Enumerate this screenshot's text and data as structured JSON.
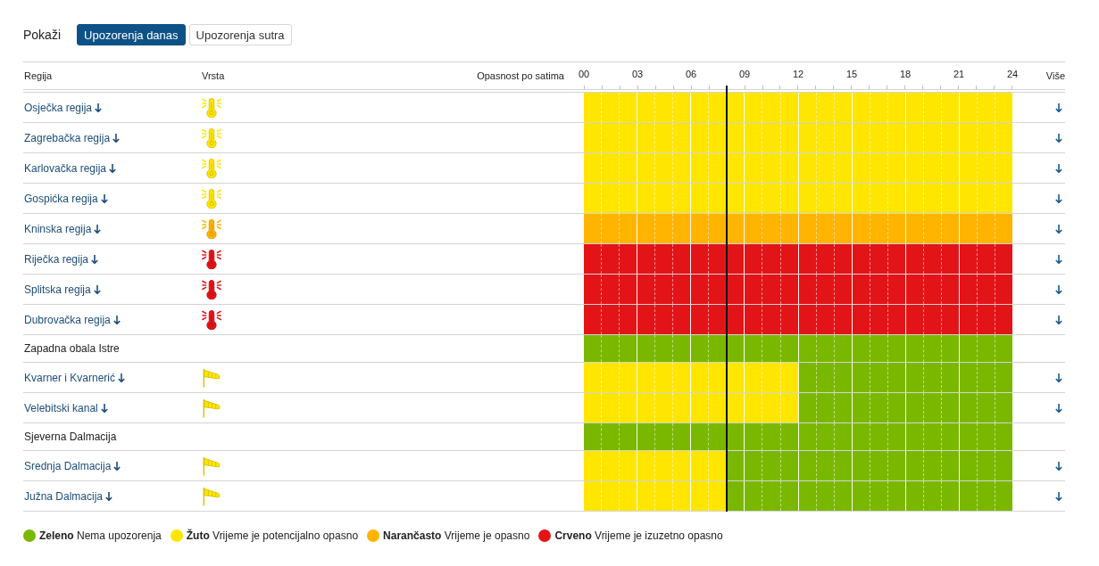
{
  "filter": {
    "label": "Pokaži",
    "tabs": [
      {
        "label": "Upozorenja danas",
        "selected": true
      },
      {
        "label": "Upozorenja sutra",
        "selected": false
      }
    ]
  },
  "table": {
    "columns": {
      "region": "Regija",
      "type": "Vrsta",
      "hazard": "Opasnost po satima",
      "more": "Više"
    },
    "hours": [
      "00",
      "03",
      "06",
      "09",
      "12",
      "15",
      "18",
      "21",
      "24"
    ],
    "now_line": {
      "level": 0.3333
    },
    "rows": [
      {
        "region": "Osječka regija",
        "expandable": true,
        "icon": {
          "kind": "heat",
          "color": "#ffe600"
        },
        "hourly": [
          {
            "color": "#ffe600"
          },
          {
            "color": "#ffe600"
          },
          {
            "color": "#ffe600"
          },
          {
            "color": "#ffe600"
          },
          {
            "color": "#ffe600"
          },
          {
            "color": "#ffe600"
          },
          {
            "color": "#ffe600"
          },
          {
            "color": "#ffe600"
          },
          {
            "color": "#ffe600"
          },
          {
            "color": "#ffe600"
          },
          {
            "color": "#ffe600"
          },
          {
            "color": "#ffe600"
          },
          {
            "color": "#ffe600"
          },
          {
            "color": "#ffe600"
          },
          {
            "color": "#ffe600"
          },
          {
            "color": "#ffe600"
          },
          {
            "color": "#ffe600"
          },
          {
            "color": "#ffe600"
          },
          {
            "color": "#ffe600"
          },
          {
            "color": "#ffe600"
          },
          {
            "color": "#ffe600"
          },
          {
            "color": "#ffe600"
          },
          {
            "color": "#ffe600"
          },
          {
            "color": "#ffe600"
          }
        ]
      },
      {
        "region": "Zagrebačka regija",
        "expandable": true,
        "icon": {
          "kind": "heat",
          "color": "#ffe600"
        },
        "hourly": [
          {
            "color": "#ffe600"
          },
          {
            "color": "#ffe600"
          },
          {
            "color": "#ffe600"
          },
          {
            "color": "#ffe600"
          },
          {
            "color": "#ffe600"
          },
          {
            "color": "#ffe600"
          },
          {
            "color": "#ffe600"
          },
          {
            "color": "#ffe600"
          },
          {
            "color": "#ffe600"
          },
          {
            "color": "#ffe600"
          },
          {
            "color": "#ffe600"
          },
          {
            "color": "#ffe600"
          },
          {
            "color": "#ffe600"
          },
          {
            "color": "#ffe600"
          },
          {
            "color": "#ffe600"
          },
          {
            "color": "#ffe600"
          },
          {
            "color": "#ffe600"
          },
          {
            "color": "#ffe600"
          },
          {
            "color": "#ffe600"
          },
          {
            "color": "#ffe600"
          },
          {
            "color": "#ffe600"
          },
          {
            "color": "#ffe600"
          },
          {
            "color": "#ffe600"
          },
          {
            "color": "#ffe600"
          }
        ]
      },
      {
        "region": "Karlovačka regija",
        "expandable": true,
        "icon": {
          "kind": "heat",
          "color": "#ffe600"
        },
        "hourly": [
          {
            "color": "#ffe600"
          },
          {
            "color": "#ffe600"
          },
          {
            "color": "#ffe600"
          },
          {
            "color": "#ffe600"
          },
          {
            "color": "#ffe600"
          },
          {
            "color": "#ffe600"
          },
          {
            "color": "#ffe600"
          },
          {
            "color": "#ffe600"
          },
          {
            "color": "#ffe600"
          },
          {
            "color": "#ffe600"
          },
          {
            "color": "#ffe600"
          },
          {
            "color": "#ffe600"
          },
          {
            "color": "#ffe600"
          },
          {
            "color": "#ffe600"
          },
          {
            "color": "#ffe600"
          },
          {
            "color": "#ffe600"
          },
          {
            "color": "#ffe600"
          },
          {
            "color": "#ffe600"
          },
          {
            "color": "#ffe600"
          },
          {
            "color": "#ffe600"
          },
          {
            "color": "#ffe600"
          },
          {
            "color": "#ffe600"
          },
          {
            "color": "#ffe600"
          },
          {
            "color": "#ffe600"
          }
        ]
      },
      {
        "region": "Gospićka regija",
        "expandable": true,
        "icon": {
          "kind": "heat",
          "color": "#ffe600"
        },
        "hourly": [
          {
            "color": "#ffe600"
          },
          {
            "color": "#ffe600"
          },
          {
            "color": "#ffe600"
          },
          {
            "color": "#ffe600"
          },
          {
            "color": "#ffe600"
          },
          {
            "color": "#ffe600"
          },
          {
            "color": "#ffe600"
          },
          {
            "color": "#ffe600"
          },
          {
            "color": "#ffe600"
          },
          {
            "color": "#ffe600"
          },
          {
            "color": "#ffe600"
          },
          {
            "color": "#ffe600"
          },
          {
            "color": "#ffe600"
          },
          {
            "color": "#ffe600"
          },
          {
            "color": "#ffe600"
          },
          {
            "color": "#ffe600"
          },
          {
            "color": "#ffe600"
          },
          {
            "color": "#ffe600"
          },
          {
            "color": "#ffe600"
          },
          {
            "color": "#ffe600"
          },
          {
            "color": "#ffe600"
          },
          {
            "color": "#ffe600"
          },
          {
            "color": "#ffe600"
          },
          {
            "color": "#ffe600"
          }
        ]
      },
      {
        "region": "Kninska regija",
        "expandable": true,
        "icon": {
          "kind": "heat",
          "color": "#ffb400"
        },
        "hourly": [
          {
            "color": "#ffb400"
          },
          {
            "color": "#ffb400"
          },
          {
            "color": "#ffb400"
          },
          {
            "color": "#ffb400"
          },
          {
            "color": "#ffb400"
          },
          {
            "color": "#ffb400"
          },
          {
            "color": "#ffb400"
          },
          {
            "color": "#ffb400"
          },
          {
            "color": "#ffb400"
          },
          {
            "color": "#ffb400"
          },
          {
            "color": "#ffb400"
          },
          {
            "color": "#ffb400"
          },
          {
            "color": "#ffb400"
          },
          {
            "color": "#ffb400"
          },
          {
            "color": "#ffb400"
          },
          {
            "color": "#ffb400"
          },
          {
            "color": "#ffb400"
          },
          {
            "color": "#ffb400"
          },
          {
            "color": "#ffb400"
          },
          {
            "color": "#ffb400"
          },
          {
            "color": "#ffb400"
          },
          {
            "color": "#ffb400"
          },
          {
            "color": "#ffb400"
          },
          {
            "color": "#ffb400"
          }
        ]
      },
      {
        "region": "Riječka regija",
        "expandable": true,
        "icon": {
          "kind": "heat",
          "color": "#e31418"
        },
        "hourly": [
          {
            "color": "#e31418"
          },
          {
            "color": "#e31418"
          },
          {
            "color": "#e31418"
          },
          {
            "color": "#e31418"
          },
          {
            "color": "#e31418"
          },
          {
            "color": "#e31418"
          },
          {
            "color": "#e31418"
          },
          {
            "color": "#e31418"
          },
          {
            "color": "#e31418"
          },
          {
            "color": "#e31418"
          },
          {
            "color": "#e31418"
          },
          {
            "color": "#e31418"
          },
          {
            "color": "#e31418"
          },
          {
            "color": "#e31418"
          },
          {
            "color": "#e31418"
          },
          {
            "color": "#e31418"
          },
          {
            "color": "#e31418"
          },
          {
            "color": "#e31418"
          },
          {
            "color": "#e31418"
          },
          {
            "color": "#e31418"
          },
          {
            "color": "#e31418"
          },
          {
            "color": "#e31418"
          },
          {
            "color": "#e31418"
          },
          {
            "color": "#e31418"
          }
        ]
      },
      {
        "region": "Splitska regija",
        "expandable": true,
        "icon": {
          "kind": "heat",
          "color": "#e31418"
        },
        "hourly": [
          {
            "color": "#e31418"
          },
          {
            "color": "#e31418"
          },
          {
            "color": "#e31418"
          },
          {
            "color": "#e31418"
          },
          {
            "color": "#e31418"
          },
          {
            "color": "#e31418"
          },
          {
            "color": "#e31418"
          },
          {
            "color": "#e31418"
          },
          {
            "color": "#e31418"
          },
          {
            "color": "#e31418"
          },
          {
            "color": "#e31418"
          },
          {
            "color": "#e31418"
          },
          {
            "color": "#e31418"
          },
          {
            "color": "#e31418"
          },
          {
            "color": "#e31418"
          },
          {
            "color": "#e31418"
          },
          {
            "color": "#e31418"
          },
          {
            "color": "#e31418"
          },
          {
            "color": "#e31418"
          },
          {
            "color": "#e31418"
          },
          {
            "color": "#e31418"
          },
          {
            "color": "#e31418"
          },
          {
            "color": "#e31418"
          },
          {
            "color": "#e31418"
          }
        ]
      },
      {
        "region": "Dubrovačka regija",
        "expandable": true,
        "icon": {
          "kind": "heat",
          "color": "#e31418"
        },
        "hourly": [
          {
            "color": "#e31418"
          },
          {
            "color": "#e31418"
          },
          {
            "color": "#e31418"
          },
          {
            "color": "#e31418"
          },
          {
            "color": "#e31418"
          },
          {
            "color": "#e31418"
          },
          {
            "color": "#e31418"
          },
          {
            "color": "#e31418"
          },
          {
            "color": "#e31418"
          },
          {
            "color": "#e31418"
          },
          {
            "color": "#e31418"
          },
          {
            "color": "#e31418"
          },
          {
            "color": "#e31418"
          },
          {
            "color": "#e31418"
          },
          {
            "color": "#e31418"
          },
          {
            "color": "#e31418"
          },
          {
            "color": "#e31418"
          },
          {
            "color": "#e31418"
          },
          {
            "color": "#e31418"
          },
          {
            "color": "#e31418"
          },
          {
            "color": "#e31418"
          },
          {
            "color": "#e31418"
          },
          {
            "color": "#e31418"
          },
          {
            "color": "#e31418"
          }
        ]
      },
      {
        "region": "Zapadna obala Istre",
        "expandable": false,
        "hourly": [
          {
            "color": "#7ab800"
          },
          {
            "color": "#7ab800"
          },
          {
            "color": "#7ab800"
          },
          {
            "color": "#7ab800"
          },
          {
            "color": "#7ab800"
          },
          {
            "color": "#7ab800"
          },
          {
            "color": "#7ab800"
          },
          {
            "color": "#7ab800"
          },
          {
            "color": "#7ab800"
          },
          {
            "color": "#7ab800"
          },
          {
            "color": "#7ab800"
          },
          {
            "color": "#7ab800"
          },
          {
            "color": "#7ab800"
          },
          {
            "color": "#7ab800"
          },
          {
            "color": "#7ab800"
          },
          {
            "color": "#7ab800"
          },
          {
            "color": "#7ab800"
          },
          {
            "color": "#7ab800"
          },
          {
            "color": "#7ab800"
          },
          {
            "color": "#7ab800"
          },
          {
            "color": "#7ab800"
          },
          {
            "color": "#7ab800"
          },
          {
            "color": "#7ab800"
          },
          {
            "color": "#7ab800"
          }
        ]
      },
      {
        "region": "Kvarner i Kvarnerić",
        "expandable": true,
        "icon": {
          "kind": "wind",
          "color": "#ffe600"
        },
        "hourly": [
          {
            "color": "#ffe600"
          },
          {
            "color": "#ffe600"
          },
          {
            "color": "#ffe600"
          },
          {
            "color": "#ffe600"
          },
          {
            "color": "#ffe600"
          },
          {
            "color": "#ffe600"
          },
          {
            "color": "#ffe600"
          },
          {
            "color": "#ffe600"
          },
          {
            "color": "#ffe600"
          },
          {
            "color": "#ffe600"
          },
          {
            "color": "#ffe600"
          },
          {
            "color": "#ffe600"
          },
          {
            "color": "#7ab800"
          },
          {
            "color": "#7ab800"
          },
          {
            "color": "#7ab800"
          },
          {
            "color": "#7ab800"
          },
          {
            "color": "#7ab800"
          },
          {
            "color": "#7ab800"
          },
          {
            "color": "#7ab800"
          },
          {
            "color": "#7ab800"
          },
          {
            "color": "#7ab800"
          },
          {
            "color": "#7ab800"
          },
          {
            "color": "#7ab800"
          },
          {
            "color": "#7ab800"
          }
        ]
      },
      {
        "region": "Velebitski kanal",
        "expandable": true,
        "icon": {
          "kind": "wind",
          "color": "#ffe600"
        },
        "hourly": [
          {
            "color": "#ffe600"
          },
          {
            "color": "#ffe600"
          },
          {
            "color": "#ffe600"
          },
          {
            "color": "#ffe600"
          },
          {
            "color": "#ffe600"
          },
          {
            "color": "#ffe600"
          },
          {
            "color": "#ffe600"
          },
          {
            "color": "#ffe600"
          },
          {
            "color": "#ffe600"
          },
          {
            "color": "#ffe600"
          },
          {
            "color": "#ffe600"
          },
          {
            "color": "#ffe600"
          },
          {
            "color": "#7ab800"
          },
          {
            "color": "#7ab800"
          },
          {
            "color": "#7ab800"
          },
          {
            "color": "#7ab800"
          },
          {
            "color": "#7ab800"
          },
          {
            "color": "#7ab800"
          },
          {
            "color": "#7ab800"
          },
          {
            "color": "#7ab800"
          },
          {
            "color": "#7ab800"
          },
          {
            "color": "#7ab800"
          },
          {
            "color": "#7ab800"
          },
          {
            "color": "#7ab800"
          }
        ]
      },
      {
        "region": "Sjeverna Dalmacija",
        "expandable": false,
        "hourly": [
          {
            "color": "#7ab800"
          },
          {
            "color": "#7ab800"
          },
          {
            "color": "#7ab800"
          },
          {
            "color": "#7ab800"
          },
          {
            "color": "#7ab800"
          },
          {
            "color": "#7ab800"
          },
          {
            "color": "#7ab800"
          },
          {
            "color": "#7ab800"
          },
          {
            "color": "#7ab800"
          },
          {
            "color": "#7ab800"
          },
          {
            "color": "#7ab800"
          },
          {
            "color": "#7ab800"
          },
          {
            "color": "#7ab800"
          },
          {
            "color": "#7ab800"
          },
          {
            "color": "#7ab800"
          },
          {
            "color": "#7ab800"
          },
          {
            "color": "#7ab800"
          },
          {
            "color": "#7ab800"
          },
          {
            "color": "#7ab800"
          },
          {
            "color": "#7ab800"
          },
          {
            "color": "#7ab800"
          },
          {
            "color": "#7ab800"
          },
          {
            "color": "#7ab800"
          },
          {
            "color": "#7ab800"
          }
        ]
      },
      {
        "region": "Srednja Dalmacija",
        "expandable": true,
        "icon": {
          "kind": "wind",
          "color": "#ffe600"
        },
        "hourly": [
          {
            "color": "#ffe600"
          },
          {
            "color": "#ffe600"
          },
          {
            "color": "#ffe600"
          },
          {
            "color": "#ffe600"
          },
          {
            "color": "#ffe600"
          },
          {
            "color": "#ffe600"
          },
          {
            "color": "#ffe600"
          },
          {
            "color": "#ffe600"
          },
          {
            "color": "#7ab800"
          },
          {
            "color": "#7ab800"
          },
          {
            "color": "#7ab800"
          },
          {
            "color": "#7ab800"
          },
          {
            "color": "#7ab800"
          },
          {
            "color": "#7ab800"
          },
          {
            "color": "#7ab800"
          },
          {
            "color": "#7ab800"
          },
          {
            "color": "#7ab800"
          },
          {
            "color": "#7ab800"
          },
          {
            "color": "#7ab800"
          },
          {
            "color": "#7ab800"
          },
          {
            "color": "#7ab800"
          },
          {
            "color": "#7ab800"
          },
          {
            "color": "#7ab800"
          },
          {
            "color": "#7ab800"
          }
        ]
      },
      {
        "region": "Južna Dalmacija",
        "expandable": true,
        "icon": {
          "kind": "wind",
          "color": "#ffe600"
        },
        "hourly": [
          {
            "color": "#ffe600"
          },
          {
            "color": "#ffe600"
          },
          {
            "color": "#ffe600"
          },
          {
            "color": "#ffe600"
          },
          {
            "color": "#ffe600"
          },
          {
            "color": "#ffe600"
          },
          {
            "color": "#ffe600"
          },
          {
            "color": "#ffe600"
          },
          {
            "color": "#7ab800"
          },
          {
            "color": "#7ab800"
          },
          {
            "color": "#7ab800"
          },
          {
            "color": "#7ab800"
          },
          {
            "color": "#7ab800"
          },
          {
            "color": "#7ab800"
          },
          {
            "color": "#7ab800"
          },
          {
            "color": "#7ab800"
          },
          {
            "color": "#7ab800"
          },
          {
            "color": "#7ab800"
          },
          {
            "color": "#7ab800"
          },
          {
            "color": "#7ab800"
          },
          {
            "color": "#7ab800"
          },
          {
            "color": "#7ab800"
          },
          {
            "color": "#7ab800"
          },
          {
            "color": "#7ab800"
          }
        ]
      }
    ]
  },
  "legend": [
    {
      "color": "#7ab800",
      "label": "**Zeleno** Nema upozorenja"
    },
    {
      "color": "#ffe600",
      "label": "**Žuto** Vrijeme je potencijalno opasno"
    },
    {
      "color": "#ffb400",
      "label": "**Narančasto** Vrijeme je opasno"
    },
    {
      "color": "#e31418",
      "label": "**Crveno** Vrijeme je izuzetno opasno"
    }
  ]
}
